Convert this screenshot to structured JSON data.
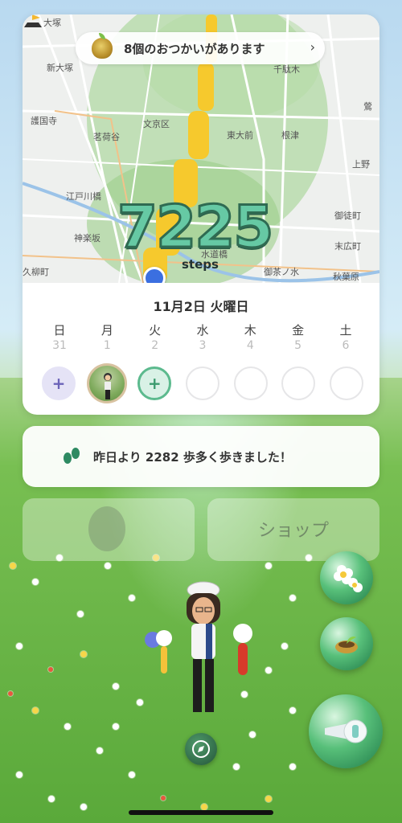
{
  "errand_banner": {
    "text": "8個のおつかいがあります",
    "chevron": "›"
  },
  "map_labels": [
    "大塚",
    "新大塚",
    "護国寺",
    "茗荷谷",
    "文京区",
    "千駄木",
    "東大前",
    "根津",
    "上野",
    "江戸川橋",
    "神楽坂",
    "御徒町",
    "末広町",
    "水道橋",
    "御茶ノ水",
    "秋葉原",
    "久柳町",
    "鶯"
  ],
  "steps": {
    "count": "7225",
    "unit": "steps"
  },
  "calendar": {
    "title": "11月2日 火曜日",
    "weekdays": [
      "日",
      "月",
      "火",
      "水",
      "木",
      "金",
      "土"
    ],
    "dates": [
      "31",
      "1",
      "2",
      "3",
      "4",
      "5",
      "6"
    ],
    "states": [
      "add",
      "photo",
      "add-today",
      "empty",
      "empty",
      "empty",
      "empty"
    ],
    "plus": "+"
  },
  "comparison": {
    "text": "昨日より 2282 歩多く歩きました！"
  },
  "tiles": {
    "shop": "ショップ"
  },
  "icons": {
    "errand": "seed-pot-icon",
    "feet": "footprints-icon",
    "flower": "flower-button-icon",
    "seedling": "seedling-pot-icon",
    "whistle": "whistle-icon",
    "compass": "compass-icon"
  },
  "colors": {
    "accent": "#66c9a4",
    "calendar_add": "#6b63b8",
    "today": "#5cba8e",
    "location": "#3b6fe0"
  }
}
